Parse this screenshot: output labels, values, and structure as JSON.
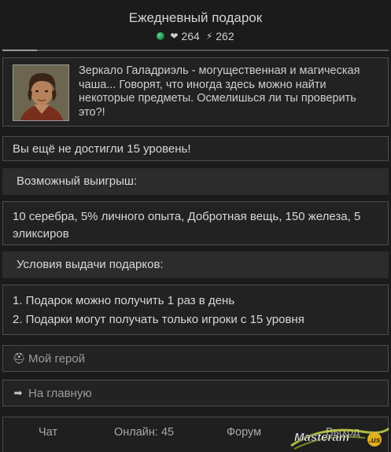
{
  "header": {
    "title": "Ежедневный подарок",
    "health": "264",
    "energy": "262"
  },
  "intro": {
    "text": "Зеркало Галадриэль - могущественная и магическая чаша... Говорят, что иногда здесь можно найти некоторые предметы. Осмелишься ли ты проверить это?!"
  },
  "level_notice": "Вы ещё не достигли 15 уровень!",
  "prize": {
    "label": "Возможный выигрыш:",
    "text": "10 серебра, 5% личного опыта, Добротная вещь, 150 железа, 5 эликсиров"
  },
  "conditions": {
    "label": "Условия выдачи подарков:",
    "items": [
      "1. Подарок можно получить 1 раз в день",
      "2. Подарки могут получать только игроки с 15 уровня"
    ]
  },
  "nav": {
    "hero": "Мой герой",
    "home": "На главную"
  },
  "footer": {
    "chat": "Чат",
    "online": "Онлайн: 45",
    "forum": "Форум",
    "exit": "Выход"
  },
  "watermark": {
    "brand": "Masteram",
    "suffix": ".us"
  }
}
